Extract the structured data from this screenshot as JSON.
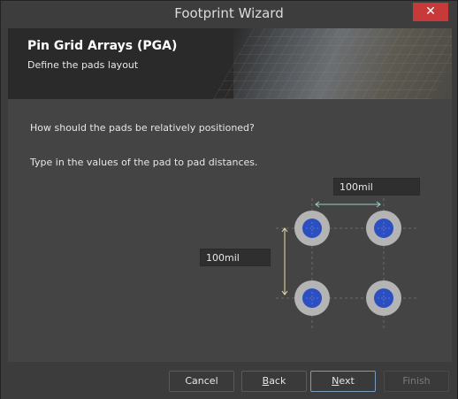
{
  "window": {
    "title": "Footprint Wizard",
    "close_glyph": "✕"
  },
  "banner": {
    "title": "Pin Grid Arrays (PGA)",
    "subtitle": "Define the pads layout"
  },
  "content": {
    "question": "How should the pads be relatively positioned?",
    "instruction": "Type in the values of the pad to pad distances.",
    "horizontal_distance": "100mil",
    "vertical_distance": "100mil"
  },
  "colors": {
    "pad_outer": "#b4b4b4",
    "pad_inner": "#2b4fc0",
    "dimension_h": "#9ad0c8",
    "dimension_v": "#e8e0a0"
  },
  "footer": {
    "cancel": "Cancel",
    "back_first": "B",
    "back_rest": "ack",
    "next_first": "N",
    "next_rest": "ext",
    "finish": "Finish"
  }
}
